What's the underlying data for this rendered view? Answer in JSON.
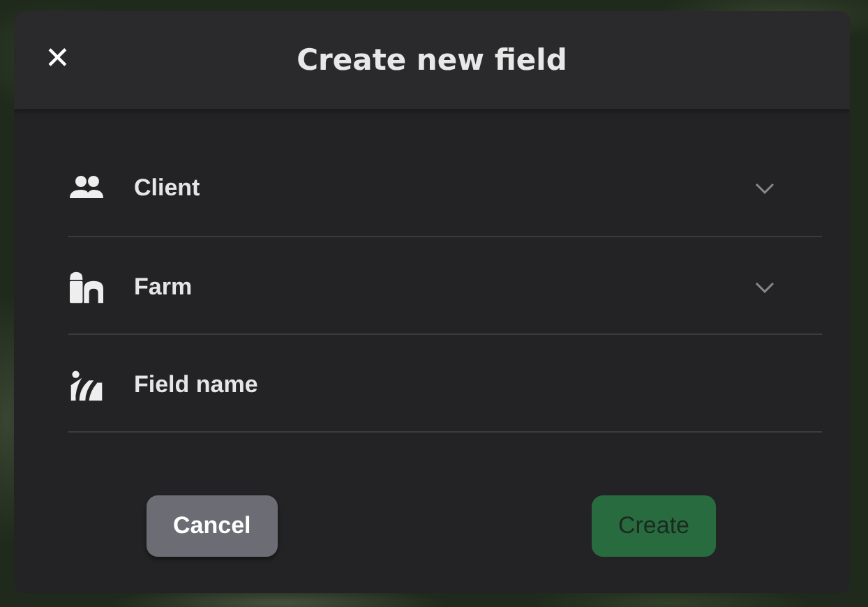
{
  "dialog": {
    "close": "✕",
    "title": "Create new field"
  },
  "fields": [
    {
      "kind": "select",
      "label": "Client"
    },
    {
      "kind": "select",
      "label": "Farm"
    },
    {
      "kind": "text",
      "label": "Field name"
    }
  ],
  "buttons": [
    {
      "kind": "secondary",
      "label": "Cancel"
    },
    {
      "kind": "primary",
      "label": "Create",
      "disabled": true
    }
  ]
}
